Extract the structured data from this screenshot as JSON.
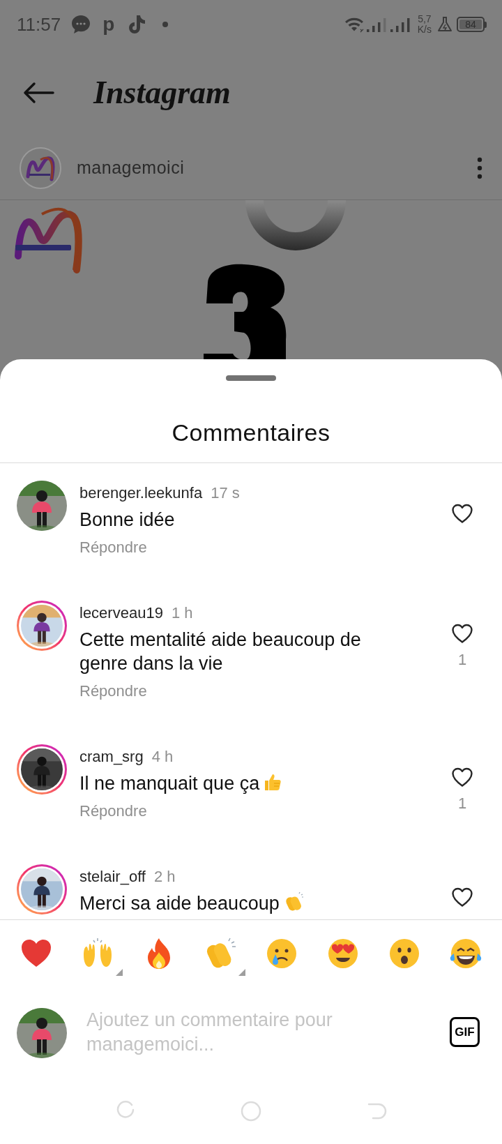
{
  "status_bar": {
    "time": "11:57",
    "notifications": [
      {
        "kind": "message"
      },
      {
        "kind": "letter",
        "glyph": "p"
      },
      {
        "kind": "music"
      },
      {
        "kind": "dot"
      }
    ],
    "net_speed": "5,7",
    "net_unit": "K/s",
    "battery": "84"
  },
  "header": {
    "title": "Instagram"
  },
  "post": {
    "username": "managemoici"
  },
  "comments_sheet": {
    "title": "Commentaires",
    "comments": [
      {
        "username": "berenger.leekunfa",
        "time": "17 s",
        "text": "Bonne idée",
        "reply": "Répondre",
        "story_ring": false
      },
      {
        "username": "lecerveau19",
        "time": "1 h",
        "text": "Cette mentalité aide beaucoup de genre dans la vie",
        "reply": "Répondre",
        "like_count": "1",
        "story_ring": true
      },
      {
        "username": "cram_srg",
        "time": "4 h",
        "text": "Il ne manquait que ça",
        "trailing_icon": {
          "kind": "thumbs_up"
        },
        "reply": "Répondre",
        "like_count": "1",
        "story_ring": true
      },
      {
        "username": "stelair_off",
        "time": "2 h",
        "text": "Merci sa aide beaucoup",
        "trailing_icon": {
          "kind": "clapping"
        },
        "story_ring": true
      }
    ]
  },
  "reactions": [
    {
      "kind": "heart",
      "has_variants": false
    },
    {
      "kind": "raised_hands",
      "has_variants": true
    },
    {
      "kind": "fire",
      "has_variants": false
    },
    {
      "kind": "clapping",
      "has_variants": true
    },
    {
      "kind": "crying",
      "has_variants": false
    },
    {
      "kind": "heart_eyes",
      "has_variants": false
    },
    {
      "kind": "surprised",
      "has_variants": false
    },
    {
      "kind": "laughing",
      "has_variants": false
    }
  ],
  "composer": {
    "placeholder": "Ajoutez un commentaire pour managemoici...",
    "gif_label": "GIF"
  }
}
